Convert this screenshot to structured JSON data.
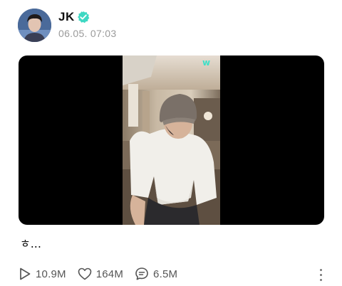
{
  "post": {
    "author": {
      "name": "JK",
      "verified": true,
      "avatar_icon": "profile-photo"
    },
    "timestamp": "06.05. 07:03",
    "media": {
      "type": "video",
      "watermark": "w"
    },
    "caption": "ㅎ...",
    "stats": {
      "plays": "10.9M",
      "likes": "164M",
      "comments": "6.5M"
    }
  },
  "colors": {
    "verified_badge": "#3ed8c3",
    "timestamp": "#9a9a9a",
    "stat_text": "#555555",
    "video_bg": "#000000",
    "watermark": "#3ee0c8"
  },
  "icons": {
    "play": "play-icon",
    "like": "heart-icon",
    "comment": "comment-icon",
    "more": "more-vertical-icon"
  }
}
